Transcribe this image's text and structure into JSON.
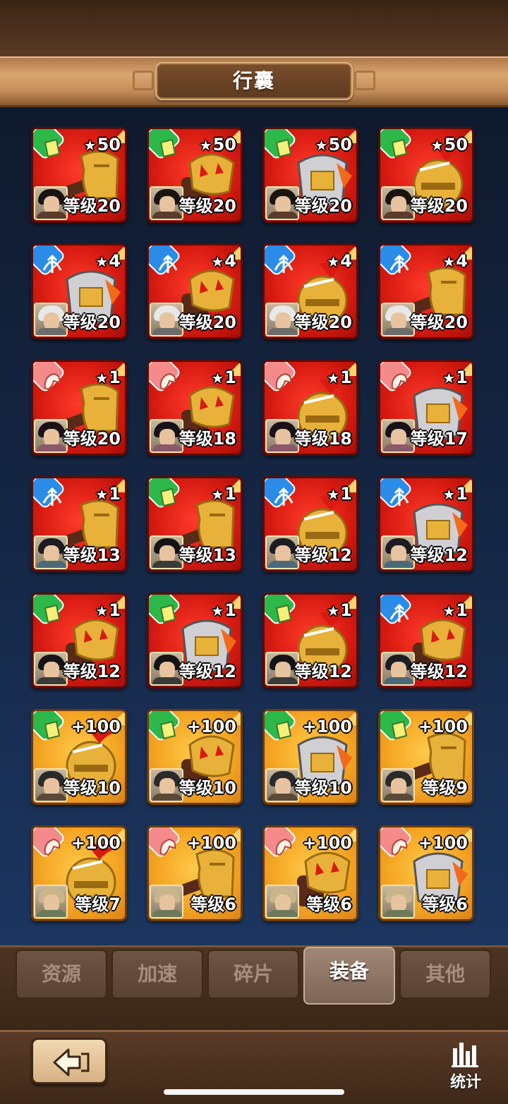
{
  "header": {
    "title": "行囊"
  },
  "items": [
    {
      "rarity": "red",
      "type": "green",
      "stack": "50",
      "star": true,
      "equip": "boots",
      "hero": "a",
      "level": "等级20"
    },
    {
      "rarity": "red",
      "type": "green",
      "stack": "50",
      "star": true,
      "equip": "gauntlet",
      "hero": "a",
      "level": "等级20"
    },
    {
      "rarity": "red",
      "type": "green",
      "stack": "50",
      "star": true,
      "equip": "armor",
      "hero": "a",
      "level": "等级20"
    },
    {
      "rarity": "red",
      "type": "green",
      "stack": "50",
      "star": true,
      "equip": "helmet",
      "hero": "a",
      "level": "等级20"
    },
    {
      "rarity": "red",
      "type": "blue",
      "stack": "4",
      "star": true,
      "equip": "armor",
      "hero": "b",
      "level": "等级20"
    },
    {
      "rarity": "red",
      "type": "blue",
      "stack": "4",
      "star": true,
      "equip": "gauntlet",
      "hero": "b",
      "level": "等级20"
    },
    {
      "rarity": "red",
      "type": "blue",
      "stack": "4",
      "star": true,
      "equip": "helmet",
      "hero": "b",
      "level": "等级20"
    },
    {
      "rarity": "red",
      "type": "blue",
      "stack": "4",
      "star": true,
      "equip": "boots",
      "hero": "b",
      "level": "等级20"
    },
    {
      "rarity": "red",
      "type": "pink",
      "stack": "1",
      "star": true,
      "equip": "boots",
      "hero": "c",
      "level": "等级20"
    },
    {
      "rarity": "red",
      "type": "pink",
      "stack": "1",
      "star": true,
      "equip": "gauntlet",
      "hero": "c",
      "level": "等级18"
    },
    {
      "rarity": "red",
      "type": "pink",
      "stack": "1",
      "star": true,
      "equip": "helmet",
      "hero": "c",
      "level": "等级18"
    },
    {
      "rarity": "red",
      "type": "pink",
      "stack": "1",
      "star": true,
      "equip": "armor",
      "hero": "c",
      "level": "等级17"
    },
    {
      "rarity": "red",
      "type": "blue",
      "stack": "1",
      "star": true,
      "equip": "boots",
      "hero": "d",
      "level": "等级13"
    },
    {
      "rarity": "red",
      "type": "green",
      "stack": "1",
      "star": true,
      "equip": "boots",
      "hero": "e",
      "level": "等级13"
    },
    {
      "rarity": "red",
      "type": "blue",
      "stack": "1",
      "star": true,
      "equip": "helmet",
      "hero": "d",
      "level": "等级12"
    },
    {
      "rarity": "red",
      "type": "blue",
      "stack": "1",
      "star": true,
      "equip": "armor",
      "hero": "d",
      "level": "等级12"
    },
    {
      "rarity": "red",
      "type": "green",
      "stack": "1",
      "star": true,
      "equip": "gauntlet",
      "hero": "e",
      "level": "等级12"
    },
    {
      "rarity": "red",
      "type": "green",
      "stack": "1",
      "star": true,
      "equip": "armor",
      "hero": "e",
      "level": "等级12"
    },
    {
      "rarity": "red",
      "type": "green",
      "stack": "1",
      "star": true,
      "equip": "helmet",
      "hero": "e",
      "level": "等级12"
    },
    {
      "rarity": "red",
      "type": "blue",
      "stack": "1",
      "star": true,
      "equip": "gauntlet",
      "hero": "d",
      "level": "等级12"
    },
    {
      "rarity": "orange",
      "type": "green",
      "stack": "+100",
      "star": false,
      "equip": "helmet",
      "hero": "f",
      "level": "等级10"
    },
    {
      "rarity": "orange",
      "type": "green",
      "stack": "+100",
      "star": false,
      "equip": "gauntlet",
      "hero": "f",
      "level": "等级10"
    },
    {
      "rarity": "orange",
      "type": "green",
      "stack": "+100",
      "star": false,
      "equip": "armor",
      "hero": "f",
      "level": "等级10"
    },
    {
      "rarity": "orange",
      "type": "green",
      "stack": "+100",
      "star": false,
      "equip": "boots",
      "hero": "f",
      "level": "等级9"
    },
    {
      "rarity": "orange",
      "type": "pink",
      "stack": "+100",
      "star": false,
      "equip": "helmet",
      "hero": "g",
      "level": "等级7"
    },
    {
      "rarity": "orange",
      "type": "pink",
      "stack": "+100",
      "star": false,
      "equip": "boots",
      "hero": "g",
      "level": "等级6"
    },
    {
      "rarity": "orange",
      "type": "pink",
      "stack": "+100",
      "star": false,
      "equip": "gauntlet",
      "hero": "g",
      "level": "等级6"
    },
    {
      "rarity": "orange",
      "type": "pink",
      "stack": "+100",
      "star": false,
      "equip": "armor",
      "hero": "g",
      "level": "等级6"
    }
  ],
  "tabs": [
    {
      "label": "资源",
      "active": false
    },
    {
      "label": "加速",
      "active": false
    },
    {
      "label": "碎片",
      "active": false
    },
    {
      "label": "装备",
      "active": true
    },
    {
      "label": "其他",
      "active": false
    }
  ],
  "footer": {
    "stats_label": "统计",
    "back_icon": "back-arrow-icon"
  },
  "colors": {
    "red_rarity": "#d91c12",
    "orange_rarity": "#f5a623",
    "type_green": "#2db84a",
    "type_blue": "#2a8ce8",
    "type_pink": "#f48a8a"
  }
}
